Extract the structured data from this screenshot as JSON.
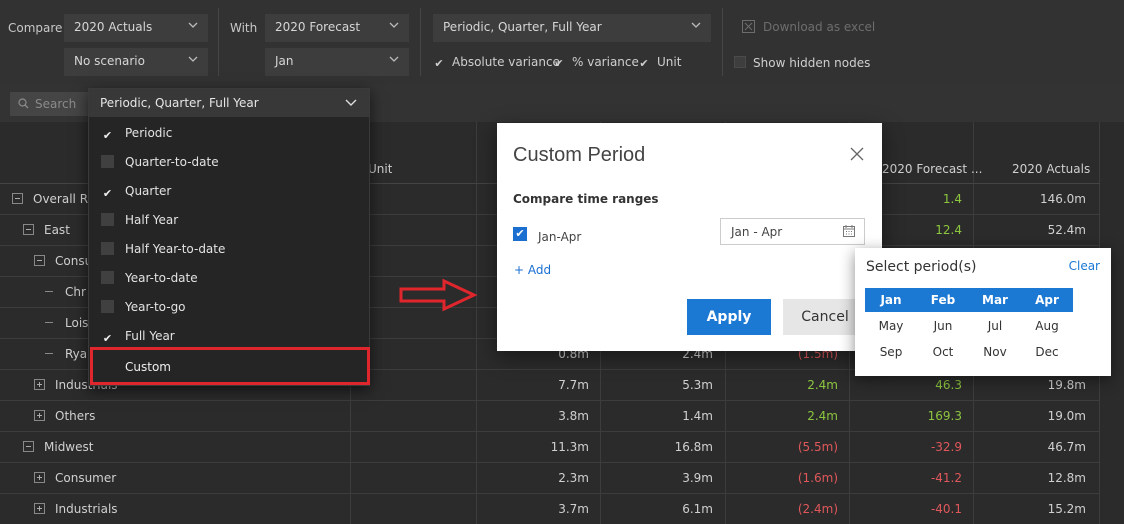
{
  "toolbar": {
    "compare_label": "Compare",
    "compare_value": "2020 Actuals",
    "compare_scenario": "No scenario",
    "with_label": "With",
    "with_value": "2020 Forecast",
    "with_period": "Jan",
    "period_value": "Periodic, Quarter, Full Year",
    "absolute_variance": "Absolute variance",
    "percent_variance": "% variance",
    "unit": "Unit",
    "download": "Download as excel",
    "show_hidden": "Show hidden nodes"
  },
  "search": {
    "placeholder": "Search"
  },
  "period_dropdown": {
    "header": "Periodic, Quarter, Full Year",
    "items": [
      {
        "label": "Periodic",
        "checked": true
      },
      {
        "label": "Quarter-to-date",
        "checked": false
      },
      {
        "label": "Quarter",
        "checked": true
      },
      {
        "label": "Half Year",
        "checked": false
      },
      {
        "label": "Half Year-to-date",
        "checked": false
      },
      {
        "label": "Year-to-date",
        "checked": false
      },
      {
        "label": "Year-to-go",
        "checked": false
      },
      {
        "label": "Full Year",
        "checked": true
      }
    ],
    "custom": "Custom"
  },
  "grid": {
    "headers": {
      "unit": "Unit",
      "forecast": "2020 Forecast ...",
      "actuals": "2020 Actuals"
    },
    "rows": [
      {
        "name": "Overall Re",
        "c1": "",
        "c2": "",
        "c3": "",
        "c4": "1.4",
        "c5": "146.0m",
        "c4c": "green",
        "c3c": ""
      },
      {
        "name": "East",
        "c1": "",
        "c2": "",
        "c3": "",
        "c4": "12.4",
        "c5": "52.4m",
        "c4c": "green",
        "c3c": ""
      },
      {
        "name": "Consu",
        "c1": "",
        "c2": "",
        "c3": "",
        "c4": "",
        "c5": "",
        "c4c": "",
        "c3c": ""
      },
      {
        "name": "Chr",
        "c1": "",
        "c2": "",
        "c3": "",
        "c4": "",
        "c5": "",
        "c4c": "",
        "c3c": ""
      },
      {
        "name": "Lois",
        "c1": "",
        "c2": "",
        "c3": "",
        "c4": "",
        "c5": "",
        "c4c": "",
        "c3c": ""
      },
      {
        "name": "Rya",
        "c1": "0.8m",
        "c2": "2.4m",
        "c3": "(1.5m)",
        "c4": "",
        "c5": "",
        "c4c": "",
        "c3c": "red"
      },
      {
        "name": "Industrials",
        "c1": "7.7m",
        "c2": "5.3m",
        "c3": "2.4m",
        "c4": "46.3",
        "c5": "19.8m",
        "c4c": "green",
        "c3c": "green"
      },
      {
        "name": "Others",
        "c1": "3.8m",
        "c2": "1.4m",
        "c3": "2.4m",
        "c4": "169.3",
        "c5": "19.0m",
        "c4c": "green",
        "c3c": "green"
      },
      {
        "name": "Midwest",
        "c1": "11.3m",
        "c2": "16.8m",
        "c3": "(5.5m)",
        "c4": "-32.9",
        "c5": "46.7m",
        "c4c": "red",
        "c3c": "red"
      },
      {
        "name": "Consumer",
        "c1": "2.3m",
        "c2": "3.9m",
        "c3": "(1.6m)",
        "c4": "-41.2",
        "c5": "12.8m",
        "c4c": "red",
        "c3c": "red"
      },
      {
        "name": "Industrials",
        "c1": "3.7m",
        "c2": "6.1m",
        "c3": "(2.4m)",
        "c4": "-40.1",
        "c5": "15.2m",
        "c4c": "red",
        "c3c": "red"
      }
    ]
  },
  "dialog": {
    "title": "Custom Period",
    "subtitle": "Compare time ranges",
    "range_label": "Jan-Apr",
    "range_value": "Jan - Apr",
    "add": "+ Add",
    "apply": "Apply",
    "cancel": "Cancel"
  },
  "popup": {
    "title": "Select period(s)",
    "clear": "Clear",
    "months": [
      "Jan",
      "Feb",
      "Mar",
      "Apr",
      "May",
      "Jun",
      "Jul",
      "Aug",
      "Sep",
      "Oct",
      "Nov",
      "Dec"
    ],
    "selected": [
      "Jan",
      "Feb",
      "Mar",
      "Apr"
    ]
  },
  "colors": {
    "accent": "#1b78d3",
    "highlight": "#e0262d",
    "positive": "#8cc63f",
    "negative": "#e0575b"
  }
}
